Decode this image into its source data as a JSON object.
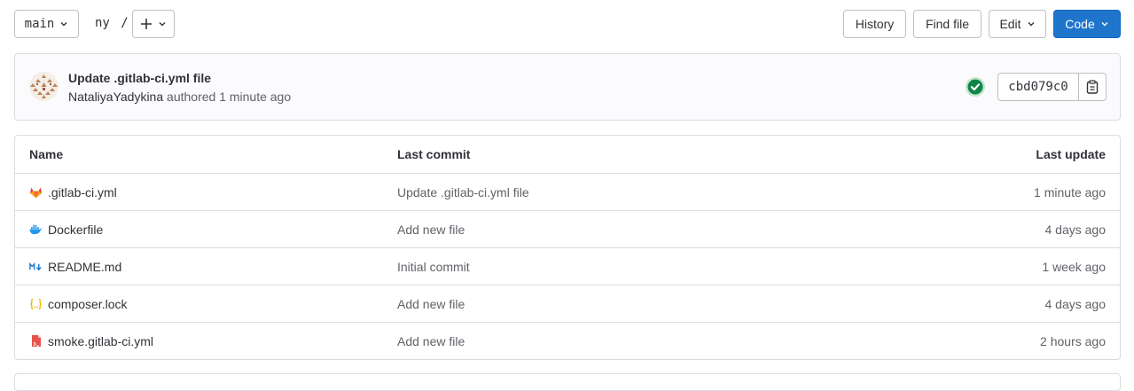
{
  "toolbar": {
    "branch": "main",
    "path": "ny",
    "path_sep": "/",
    "history_label": "History",
    "find_file_label": "Find file",
    "edit_label": "Edit",
    "code_label": "Code"
  },
  "commit": {
    "title": "Update .gitlab-ci.yml file",
    "author": "NataliyaYadykina",
    "authored_text": "authored 1 minute ago",
    "pipeline_status": "passed",
    "sha": "cbd079c0"
  },
  "table": {
    "headers": {
      "name": "Name",
      "last_commit": "Last commit",
      "last_update": "Last update"
    },
    "rows": [
      {
        "name": ".gitlab-ci.yml",
        "commit": "Update .gitlab-ci.yml file",
        "updated": "1 minute ago",
        "icon": "gitlab-icon"
      },
      {
        "name": "Dockerfile",
        "commit": "Add new file",
        "updated": "4 days ago",
        "icon": "docker-icon"
      },
      {
        "name": "README.md",
        "commit": "Initial commit",
        "updated": "1 week ago",
        "icon": "markdown-icon"
      },
      {
        "name": "composer.lock",
        "commit": "Add new file",
        "updated": "4 days ago",
        "icon": "json-braces-icon"
      },
      {
        "name": "smoke.gitlab-ci.yml",
        "commit": "Add new file",
        "updated": "2 hours ago",
        "icon": "yaml-file-icon"
      }
    ]
  },
  "colors": {
    "primary": "#1f75cb",
    "success": "#108548",
    "border": "#dcdcde"
  }
}
